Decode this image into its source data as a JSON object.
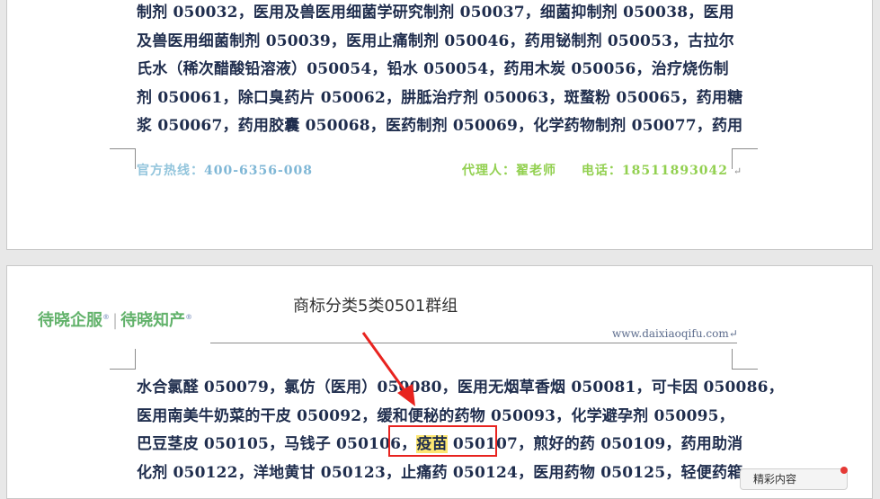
{
  "page1": {
    "lines": [
      "制剂 050032，医用及兽医用细菌学研究制剂 050037，细菌抑制剂 050038，医用",
      "及兽医用细菌制剂 050039，医用止痛制剂 050046，药用铋制剂 050053，古拉尔",
      "氏水（稀次醋酸铅溶液）050054，铅水 050054，药用木炭 050056，治疗烧伤制",
      "剂 050061，除口臭药片 050062，肼胝治疗剂 050063，斑蝥粉 050065，药用糖",
      "浆 050067，药用胶囊 050068，医药制剂 050069，化学药物制剂 050077，药用"
    ],
    "footer": {
      "hotline_label": "官方热线：",
      "hotline_number": "400-6356-008",
      "agent": "代理人：翟老师",
      "phone_label": "电话：",
      "phone_number": "18511893042",
      "paragraph_mark": "↵"
    }
  },
  "page2": {
    "logo": {
      "part1": "待晓企服",
      "separator": "|",
      "part2": "待晓知产",
      "reg_mark": "®"
    },
    "header_title": "商标分类5类0501群组",
    "header_url": "www.daixiaoqifu.com↵",
    "lines": [
      "水合氯醛 050079，氯仿（医用）050080，医用无烟草香烟 050081，可卡因 050086，",
      "医用南美牛奶菜的干皮 050092，缓和便秘的药物 050093，化学避孕剂 050095，",
      "巴豆茎皮 050105，马钱子 050106，",
      "化剂 050122，洋地黄甘 050123，止痛药 050124，医用药物 050125，轻便药箱"
    ],
    "highlight_word": "疫苗",
    "highlight_rest": " 050107，",
    "line3_tail": "煎好的药 050109，药用助消"
  },
  "annotation": {
    "color": "#e8231f"
  },
  "side_widget": {
    "label": "精彩内容"
  }
}
